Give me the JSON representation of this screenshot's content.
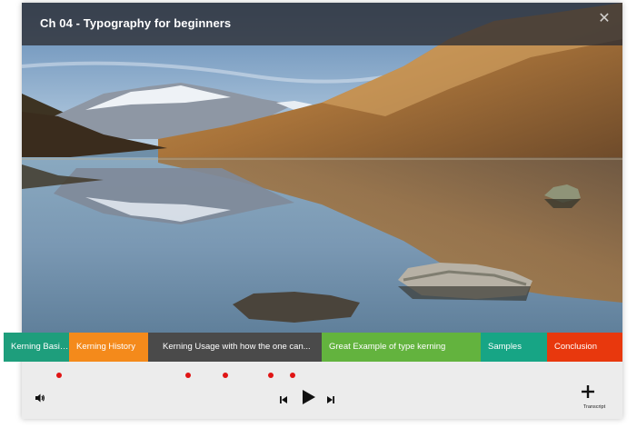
{
  "header": {
    "title": "Ch 04 - Typography for beginners",
    "close_icon": "close-icon"
  },
  "chapters": [
    {
      "label": "Kerning Basic...",
      "color": "#1e9e7c",
      "active": true
    },
    {
      "label": "Kerning History",
      "color": "#f48a1b",
      "active": false
    },
    {
      "label": "Kerning Usage with how the one can...",
      "color": "#4a4a4a",
      "active": false
    },
    {
      "label": "Great Example of type kerning",
      "color": "#63b33e",
      "active": false
    },
    {
      "label": "Samples",
      "color": "#17a585",
      "active": false
    },
    {
      "label": "Conclusion",
      "color": "#e8380d",
      "active": false
    }
  ],
  "controls": {
    "volume_icon": "volume-icon",
    "previous_icon": "skip-previous-icon",
    "play_icon": "play-icon",
    "next_icon": "skip-next-icon",
    "transcript_icon": "plus-icon",
    "transcript_label": "Transcript"
  },
  "marker_count": 5
}
